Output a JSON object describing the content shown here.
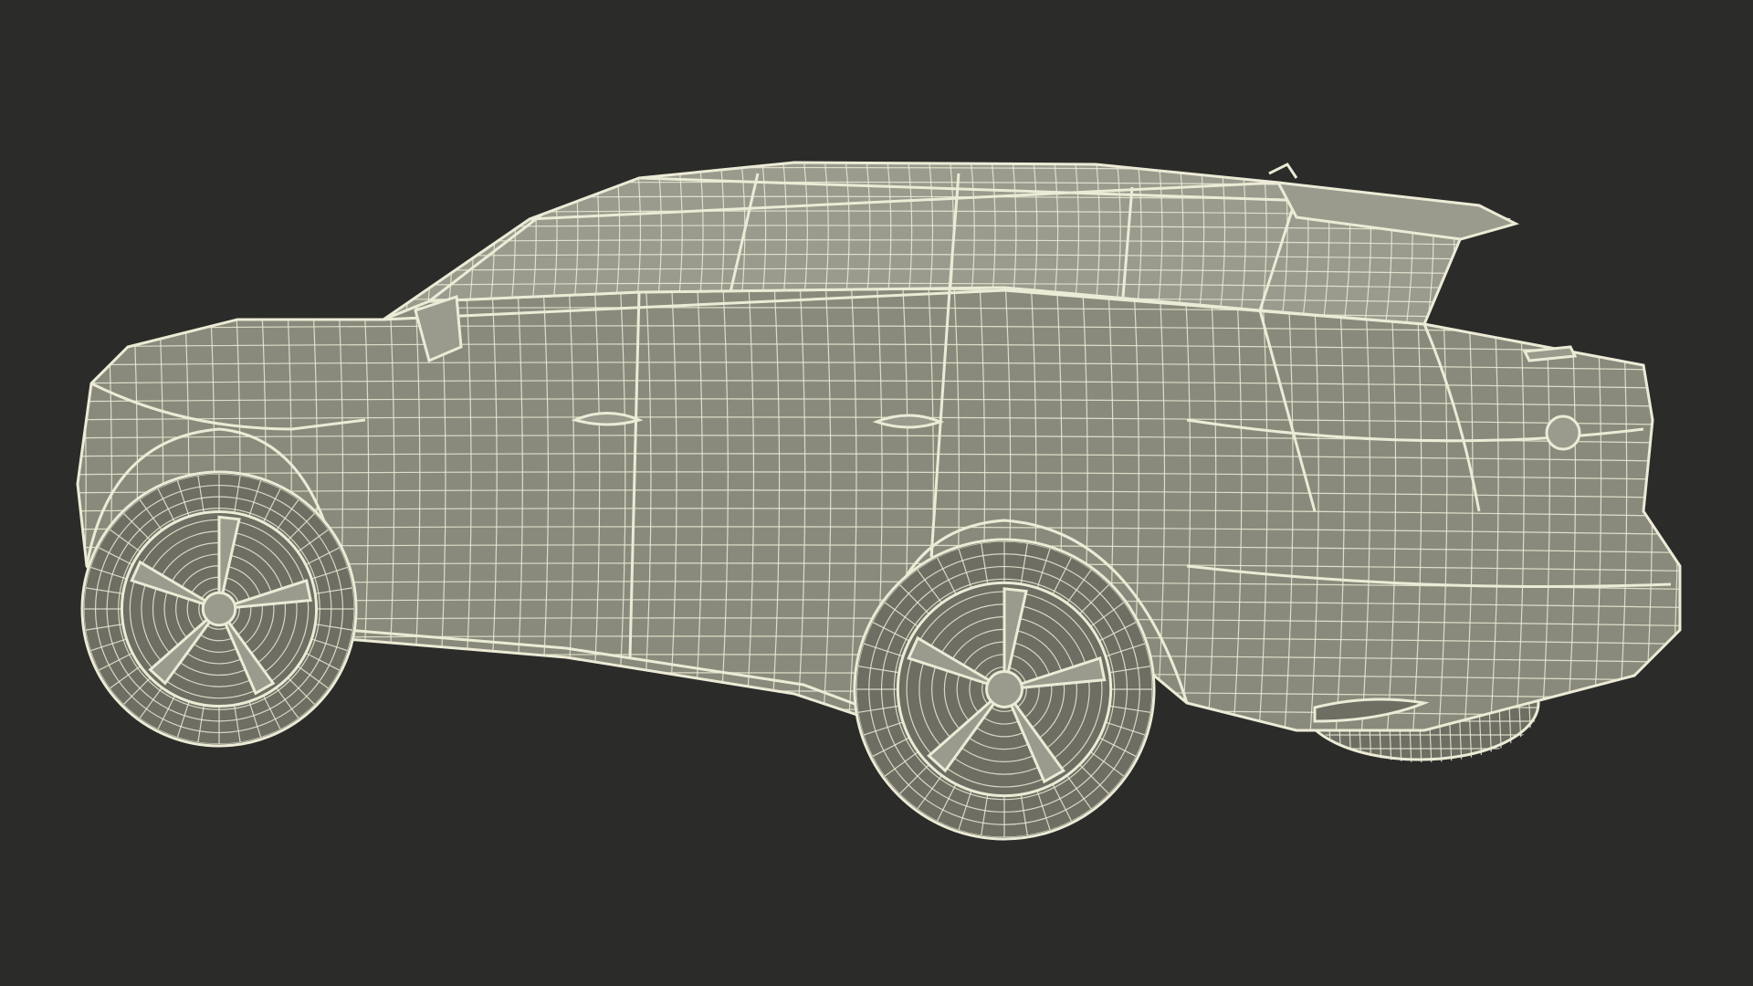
{
  "scene": {
    "subject": "car-wireframe",
    "view": "rear-three-quarter",
    "colors": {
      "background": "#2b2b2a",
      "surface": "#8a8a7c",
      "surface_dark": "#6e6e63",
      "surface_light": "#9a9a8d",
      "wire": "#ecebd6",
      "shadow": "#56564d"
    }
  }
}
